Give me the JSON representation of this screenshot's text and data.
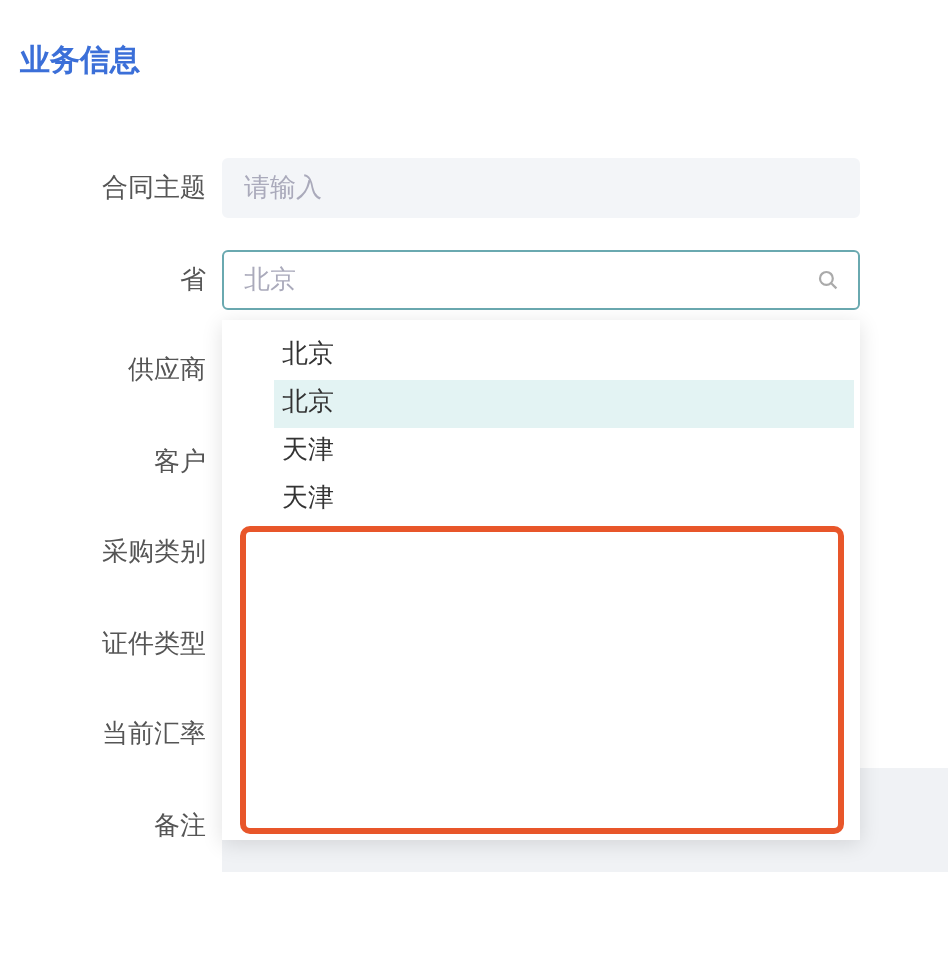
{
  "section": {
    "title": "业务信息"
  },
  "fields": [
    {
      "label": "合同主题",
      "kind": "input",
      "placeholder": "请输入"
    },
    {
      "label": "省",
      "kind": "select",
      "placeholder": "北京"
    },
    {
      "label": "供应商",
      "kind": "covered"
    },
    {
      "label": "客户",
      "kind": "covered"
    },
    {
      "label": "采购类别",
      "kind": "covered"
    },
    {
      "label": "证件类型",
      "kind": "covered"
    },
    {
      "label": "当前汇率",
      "kind": "covered"
    },
    {
      "label": "备注",
      "kind": "textarea"
    }
  ],
  "dropdown": {
    "open": true,
    "options": [
      {
        "label": "北京",
        "selected": false
      },
      {
        "label": "北京",
        "selected": true
      },
      {
        "label": "天津",
        "selected": false
      },
      {
        "label": "天津",
        "selected": false
      }
    ]
  },
  "annotation": {
    "kind": "highlight-box",
    "color": "#e8562a"
  }
}
